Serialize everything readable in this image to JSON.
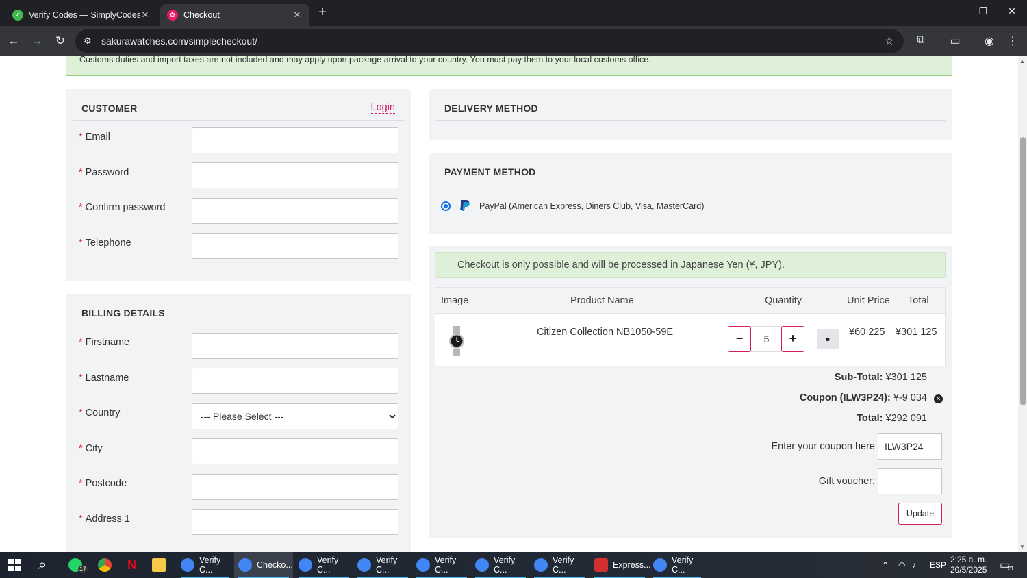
{
  "browser": {
    "tabs": [
      {
        "title": "Verify Codes — SimplyCodes",
        "active": false
      },
      {
        "title": "Checkout",
        "active": true
      }
    ],
    "url": "sakurawatches.com/simplecheckout/"
  },
  "notice": "Customs duties and import taxes are not included and may apply upon package arrival to your country. You must pay them to your local customs office.",
  "customer": {
    "heading": "CUSTOMER",
    "login_label": "Login",
    "fields": [
      {
        "label": "Email",
        "value": ""
      },
      {
        "label": "Password",
        "value": ""
      },
      {
        "label": "Confirm password",
        "value": ""
      },
      {
        "label": "Telephone",
        "value": ""
      }
    ]
  },
  "billing": {
    "heading": "BILLING DETAILS",
    "fields": [
      {
        "label": "Firstname",
        "value": ""
      },
      {
        "label": "Lastname",
        "value": ""
      },
      {
        "label": "Country",
        "value": "--- Please Select ---"
      },
      {
        "label": "City",
        "value": ""
      },
      {
        "label": "Postcode",
        "value": ""
      },
      {
        "label": "Address 1",
        "value": ""
      }
    ]
  },
  "delivery": {
    "heading": "DELIVERY METHOD"
  },
  "payment": {
    "heading": "PAYMENT METHOD",
    "option": "PayPal (American Express, Diners Club, Visa, MasterCard)",
    "selected": true
  },
  "cart": {
    "notice": "Checkout is only possible and will be processed in Japanese Yen (¥, JPY).",
    "columns": [
      "Image",
      "Product Name",
      "Quantity",
      "Unit Price",
      "Total"
    ],
    "items": [
      {
        "name": "Citizen Collection NB1050-59E",
        "quantity": "5",
        "unit_price": "¥60 225",
        "total": "¥301 125"
      }
    ],
    "subtotal_label": "Sub-Total:",
    "subtotal": "¥301 125",
    "coupon_label": "Coupon (ILW3P24):",
    "coupon_value": "¥-9 034",
    "total_label": "Total:",
    "total": "¥292 091",
    "coupon_input_label": "Enter your coupon here",
    "coupon_input_value": "ILW3P24",
    "voucher_label": "Gift voucher:",
    "voucher_value": "",
    "update_label": "Update"
  },
  "taskbar": {
    "items": [
      {
        "label": "Verify C..."
      },
      {
        "label": "Checko..."
      },
      {
        "label": "Verify C..."
      },
      {
        "label": "Verify C..."
      },
      {
        "label": "Verify C..."
      },
      {
        "label": "Verify C..."
      },
      {
        "label": "Verify C..."
      },
      {
        "label": "Express..."
      },
      {
        "label": "Verify C..."
      }
    ],
    "whatsapp_badge": "17",
    "language": "ESP",
    "time": "2:25 a. m.",
    "date": "20/5/2025",
    "notifications": "21"
  },
  "colors": {
    "accent": "#d81b60",
    "notice_bg": "#dff0d8",
    "panel_bg": "#f2f3f5"
  }
}
